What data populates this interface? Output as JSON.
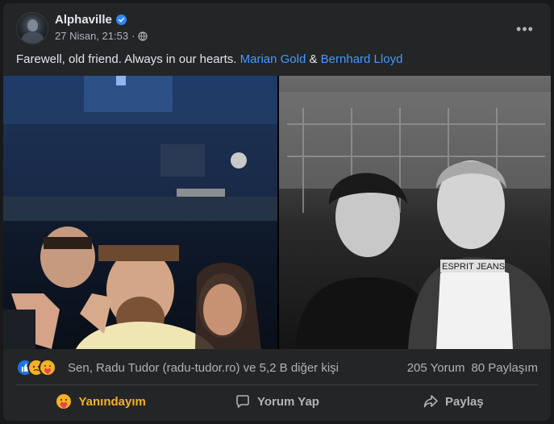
{
  "post": {
    "page_name": "Alphaville",
    "verified_icon": "verified-badge-icon",
    "date": "27 Nisan, 21:53",
    "separator": "·",
    "audience_icon": "globe-icon",
    "more_label": "•••"
  },
  "caption": {
    "text": "Farewell, old friend. Always in our hearts. ",
    "mention_1": "Marian Gold",
    "joiner": " & ",
    "mention_2": "Bernhard Lloyd"
  },
  "photos": [
    {
      "name": "studio-photo",
      "icon": "photo"
    },
    {
      "name": "bw-portrait-photo",
      "icon": "photo"
    }
  ],
  "engagement": {
    "reactions": [
      "like-reaction-icon",
      "sad-reaction-icon",
      "care-reaction-icon"
    ],
    "reactors_text": "Sen, Radu Tudor (radu-tudor.ro) ve 5,2 B diğer kişi",
    "comments": "205 Yorum",
    "shares": "80 Paylaşım"
  },
  "actions": {
    "react_label": "Yanındayım",
    "comment_label": "Yorum Yap",
    "share_label": "Paylaş"
  },
  "colors": {
    "background": "#18191a",
    "card": "#242526",
    "text_primary": "#e4e6eb",
    "text_secondary": "#b0b3b8",
    "link": "#4599ff",
    "verified": "#2d88ff",
    "care_reaction": "#f7b125"
  }
}
